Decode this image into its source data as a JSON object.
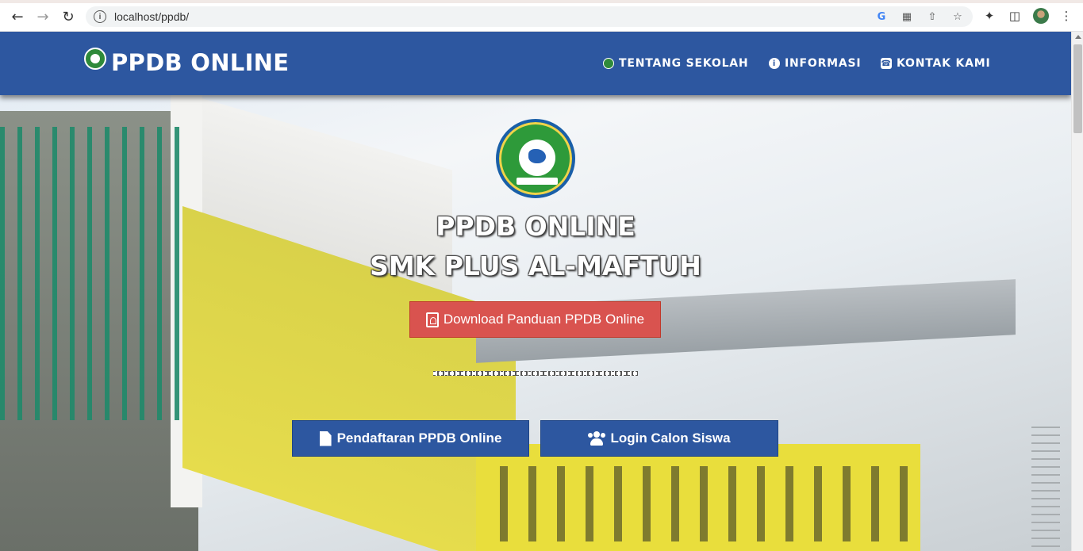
{
  "browser": {
    "url": "localhost/ppdb/",
    "icons": [
      "back-icon",
      "forward-icon",
      "reload-icon",
      "site-info-icon",
      "google-icon",
      "translate-icon",
      "share-icon",
      "bookmark-star-icon",
      "extensions-icon",
      "side-panel-icon",
      "profile-avatar",
      "menu-kebab-icon"
    ]
  },
  "navbar": {
    "brand": "PPDB ONLINE",
    "menu": [
      {
        "label": "TENTANG SEKOLAH",
        "icon": "school-logo-icon"
      },
      {
        "label": "INFORMASI",
        "icon": "info-icon"
      },
      {
        "label": "KONTAK KAMI",
        "icon": "phone-icon"
      }
    ]
  },
  "hero": {
    "title_line1": "PPDB ONLINE",
    "title_line2": "SMK PLUS AL-MAFTUH",
    "download_button": "Download Panduan PPDB Online",
    "register_button": "Pendaftaran PPDB Online",
    "login_button": "Login Calon Siswa"
  },
  "colors": {
    "navbar": "#2d57a0",
    "download_button": "#d9534f",
    "primary_button": "#2d57a0"
  }
}
